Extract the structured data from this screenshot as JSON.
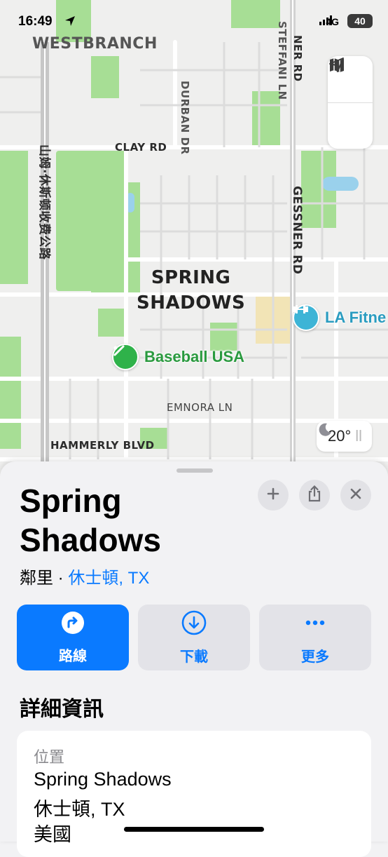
{
  "status_bar": {
    "time": "16:49",
    "network": "4G",
    "battery": "40"
  },
  "map": {
    "neighborhood_label": "SPRING\nSHADOWS",
    "streets": {
      "westbranch": "WESTBRANCH",
      "clay_rd": "CLAY RD",
      "durban_dr": "DURBAN DR",
      "steffani_ln": "STEFFANI LN",
      "gessner_rd_top": "NER RD",
      "gessner_rd": "GESSNER RD",
      "tollway": "山姆·休斯顿收费公路",
      "emnora_ln": "EMNORA LN",
      "hammerly_blvd": "HAMMERLY BLVD"
    },
    "pois": {
      "baseball": "Baseball USA",
      "la_fitness": "LA Fitne"
    },
    "weather": {
      "temperature": "20°",
      "extra": "ll"
    }
  },
  "sheet": {
    "title": "Spring Shadows",
    "subtitle_type": "鄰里",
    "subtitle_sep": " · ",
    "subtitle_city": "休士頓, TX",
    "actions": {
      "directions": "路線",
      "download": "下載",
      "more": "更多"
    },
    "details_heading": "詳細資訊",
    "location_label": "位置",
    "address_lines": [
      "Spring Shadows",
      "休士頓, TX",
      "美國"
    ]
  },
  "colors": {
    "accent": "#0a7aff",
    "park": "#9edc8a",
    "fitness": "#3db4d6",
    "baseball": "#2fb24a"
  }
}
